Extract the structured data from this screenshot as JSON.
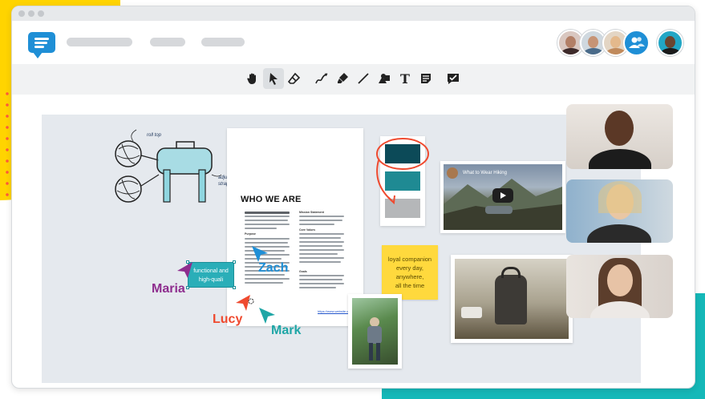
{
  "colors": {
    "accent_blue": "#1f8fd6",
    "teal": "#15b8b8",
    "yellow": "#ffd400",
    "maria": "#8e2d8e",
    "lucy": "#ef4a2f",
    "zach": "#1f8fd6",
    "mark": "#1fa6a6",
    "swatch_dark": "#0c4a58",
    "swatch_mid": "#1f8a93",
    "swatch_light": "#b5b7b9"
  },
  "toolbar": {
    "tools": [
      "hand-icon",
      "pointer-icon",
      "eraser-icon",
      "pen-icon",
      "highlighter-icon",
      "line-icon",
      "shapes-icon",
      "text-icon",
      "sticky-note-icon",
      "comment-icon"
    ],
    "text_glyph": "T"
  },
  "sketch": {
    "label_top": "roll top",
    "label_right": "adjustable straps"
  },
  "document": {
    "title": "WHO WE ARE",
    "col2_heading1": "Mission Statement",
    "col2_heading2": "Core Values",
    "col1_heading": "Purpose",
    "col2_heading3": "Goals",
    "link_text": "https://www.website.com"
  },
  "video": {
    "title": "What to Wear Hiking"
  },
  "sticky_note": {
    "line1": "loyal companion",
    "line2": "every day,",
    "line3": "anywhere,",
    "line4": "all the time"
  },
  "shape": {
    "line1": "functional and",
    "line2": "high-quali"
  },
  "cursors": {
    "maria": "Maria",
    "lucy": "Lucy",
    "zach": "Zach",
    "mark": "Mark"
  }
}
